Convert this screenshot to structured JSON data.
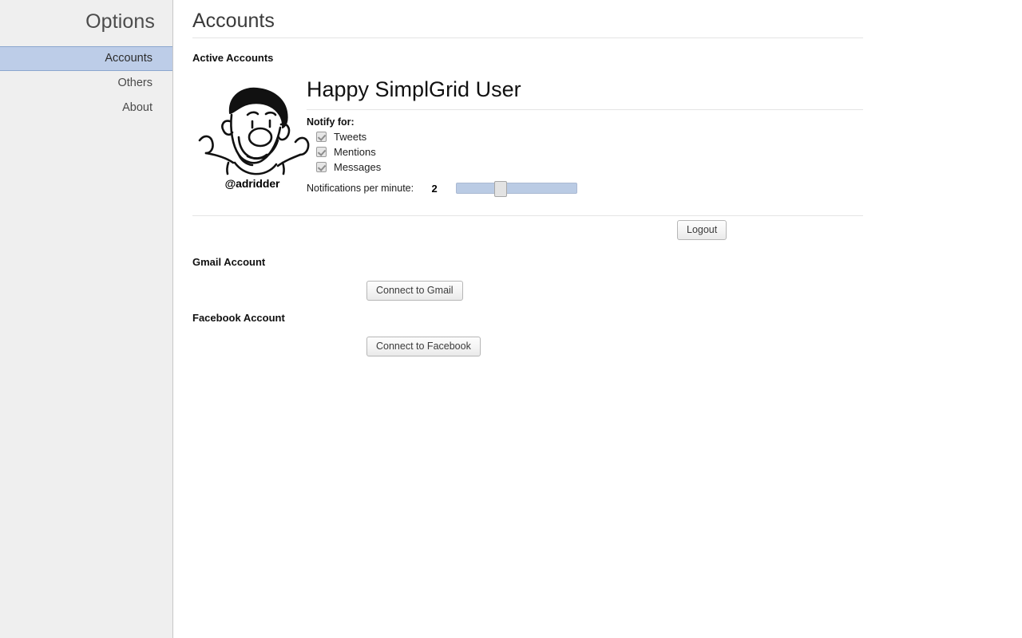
{
  "sidebar": {
    "title": "Options",
    "items": [
      {
        "label": "Accounts",
        "selected": true
      },
      {
        "label": "Others",
        "selected": false
      },
      {
        "label": "About",
        "selected": false
      }
    ]
  },
  "main": {
    "page_title": "Accounts",
    "active_accounts_heading": "Active Accounts",
    "account": {
      "avatar_alt": "cartoon-face-avatar",
      "handle": "@adridder",
      "display_name": "Happy SimplGrid User",
      "notify_label": "Notify for:",
      "notify_options": [
        {
          "label": "Tweets",
          "checked": true
        },
        {
          "label": "Mentions",
          "checked": true
        },
        {
          "label": "Messages",
          "checked": true
        }
      ],
      "rate_label": "Notifications per minute:",
      "rate_value": "2",
      "slider": {
        "min": "0",
        "max": "10",
        "value": "2",
        "track_color": "#bacbe4",
        "thumb_color": "#e3e3e3"
      },
      "logout_label": "Logout"
    },
    "gmail": {
      "heading": "Gmail Account",
      "connect_label": "Connect to Gmail"
    },
    "facebook": {
      "heading": "Facebook Account",
      "connect_label": "Connect to Facebook"
    }
  },
  "colors": {
    "sidebar_bg": "#efefef",
    "selected_item_bg": "#bdcde8",
    "selected_item_border": "#8ba7ce",
    "rule": "#e4e4e4",
    "page_bg": "#ffffff"
  }
}
